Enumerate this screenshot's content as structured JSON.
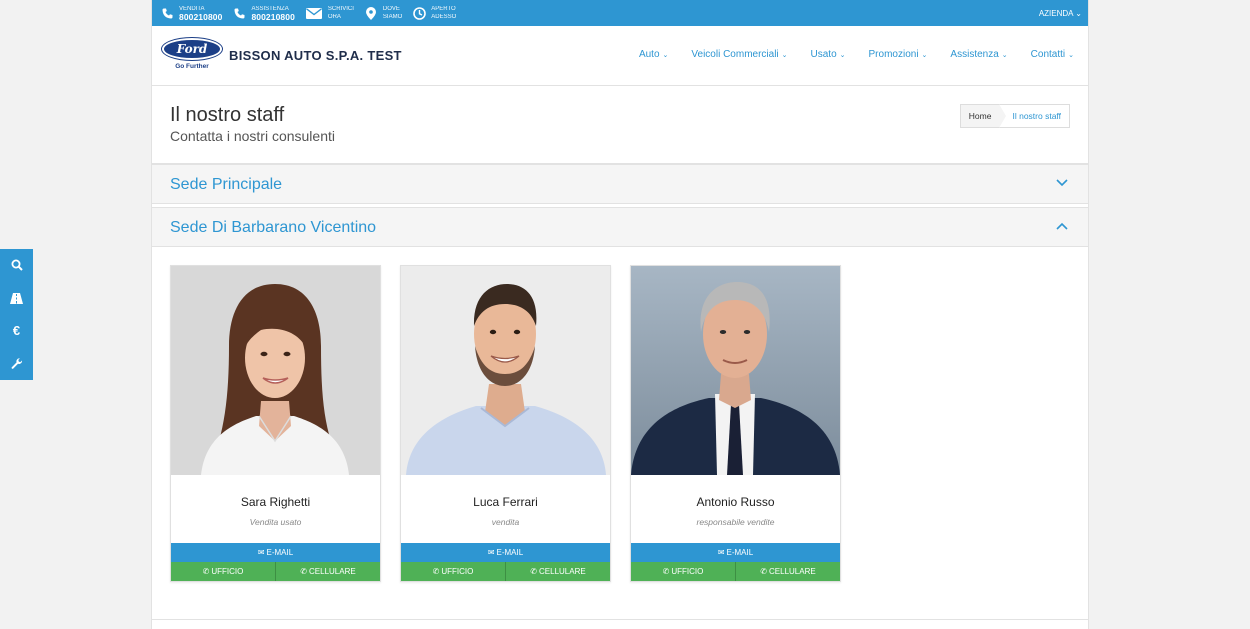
{
  "topbar": {
    "items": [
      {
        "icon": "phone-icon",
        "small": "VENDITA",
        "big": "800210800"
      },
      {
        "icon": "phone-icon",
        "small": "ASSISTENZA",
        "big": "800210800"
      },
      {
        "icon": "envelope-icon",
        "small": "SCRIVICI",
        "big": "ORA"
      },
      {
        "icon": "map-pin-icon",
        "small": "DOVE",
        "big": "SIAMO"
      },
      {
        "icon": "clock-icon",
        "small": "APERTO",
        "big": "ADESSO"
      }
    ],
    "azienda": "AZIENDA"
  },
  "header": {
    "logo_text": "Ford",
    "logo_tagline": "Go Further",
    "brand": "BISSON AUTO S.P.A. TEST",
    "nav": [
      "Auto",
      "Veicoli Commerciali",
      "Usato",
      "Promozioni",
      "Assistenza",
      "Contatti"
    ]
  },
  "page": {
    "title": "Il nostro staff",
    "subtitle": "Contatta i nostri consulenti",
    "breadcrumb": {
      "home": "Home",
      "current": "Il nostro staff"
    }
  },
  "sections": [
    {
      "title": "Sede Principale",
      "expanded": false
    },
    {
      "title": "Sede Di Barbarano Vicentino",
      "expanded": true
    }
  ],
  "staff": [
    {
      "name": "Sara Righetti",
      "role": "Vendita usato",
      "email": "E-MAIL",
      "office": "UFFICIO",
      "mobile": "CELLULARE"
    },
    {
      "name": "Luca Ferrari",
      "role": "vendita",
      "email": "E-MAIL",
      "office": "UFFICIO",
      "mobile": "CELLULARE"
    },
    {
      "name": "Antonio Russo",
      "role": "responsabile vendite",
      "email": "E-MAIL",
      "office": "UFFICIO",
      "mobile": "CELLULARE"
    }
  ],
  "side_tools": [
    "search-icon",
    "road-icon",
    "euro-icon",
    "wrench-icon"
  ],
  "colors": {
    "accent": "#2e96d2",
    "green": "#4fb156",
    "ford_blue": "#1c3f87"
  }
}
